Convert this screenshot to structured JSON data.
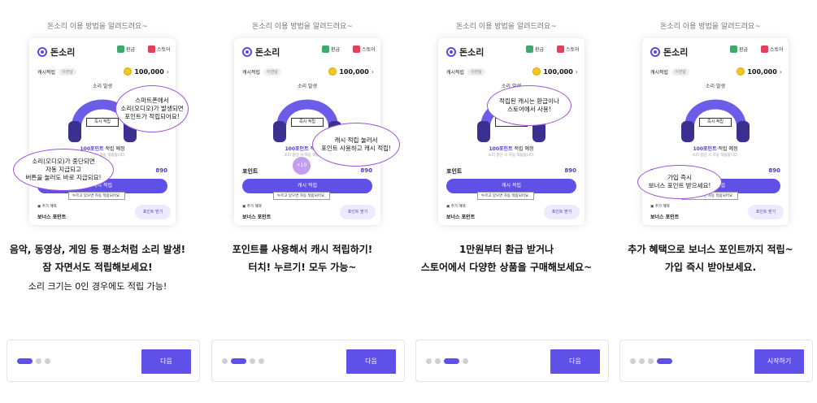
{
  "panels": [
    {
      "top_caption": "돈소리 이용 방법을 알려드려요~",
      "headline": "음악, 동영상, 게임 등 평소처럼 소리 발생!\n잠 자면서도 적립해보세요!",
      "subline": "소리 크기는 0인 경우에도 적립 가능!",
      "bubbles": [
        "스마트폰에서\n소리(오디오)가 발생되면\n포인트가 적립되어요!",
        "소리(오디오)가 중단되면\n자동 지급되고\n버튼을 눌러도 바로 지급되요!"
      ],
      "button": "다음"
    },
    {
      "top_caption": "돈소리 이용 방법을 알려드려요~",
      "headline": "포인트를 사용해서 캐시 적립하기!\n터치! 누르기! 모두 가능~",
      "subline": "",
      "bubbles": [
        "캐시 적립 눌러서\n포인트 사용하고 캐시 적립!"
      ],
      "badge": "+10",
      "button": "다음"
    },
    {
      "top_caption": "돈소리 이용 방법을 알려드려요~",
      "headline": "1만원부터 환급 받거나\n스토어에서 다양한 상품을 구매해보세요~",
      "subline": "",
      "bubbles": [
        "적립된 캐시는 환급이나\n스토어에서 사용!"
      ],
      "button": "다음"
    },
    {
      "top_caption": "돈소리 이용 방법을 알려드려요~",
      "headline": "추가 혜택으로 보너스 포인트까지 적립~\n가입 즉시 받아보세요.",
      "subline": "",
      "bubbles": [
        "가입 즉시\n보너스 포인트 받으세요!"
      ],
      "button": "시작하기"
    }
  ],
  "card": {
    "brand": "돈소리",
    "refund": "환급",
    "store": "스토어",
    "cash_label": "캐시적립",
    "cash_tag": "이번달",
    "cash_value": "100,000",
    "sound_label": "소리 발생",
    "accum_button": "즉시 적립",
    "points_est_pre": "100포인트",
    "points_est_post": " 적립 예정",
    "points_sub": "소리 중단 시 자동 적립됩니다.",
    "points_label": "포인트",
    "points_value": "890",
    "main_button": "캐시 적립",
    "main_note": "누르고 있으면 자동 적립되어요.",
    "extra_label": "추가 혜택",
    "bonus_label": "보너스 포인트",
    "bonus_button": "포인트 받기"
  },
  "colors": {
    "accent": "#5f51e8",
    "bubble_border": "#9d51d9",
    "refund_icon": "#3fa96b",
    "store_icon": "#e0405a"
  }
}
